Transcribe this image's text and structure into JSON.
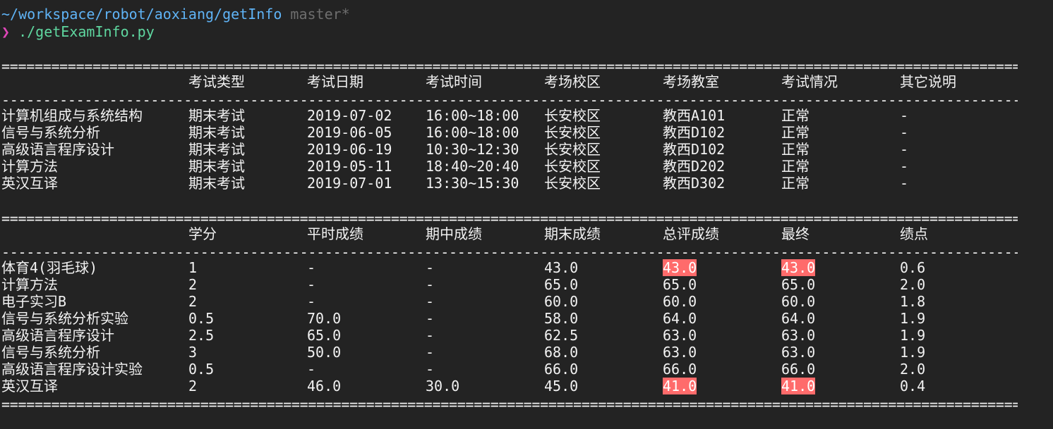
{
  "prompt": {
    "path": "~/workspace/robot/aoxiang/getInfo",
    "branch": "master*",
    "caret": "❯",
    "command": "./getExamInfo.py"
  },
  "exam_table": {
    "columns": [
      "",
      "考试类型",
      "考试日期",
      "考试时间",
      "考场校区",
      "考场教室",
      "考试情况",
      "其它说明"
    ],
    "rows": [
      [
        "计算机组成与系统结构",
        "期末考试",
        "2019-07-02",
        "16:00~18:00",
        "长安校区",
        "教西A101",
        "正常",
        "-"
      ],
      [
        "信号与系统分析",
        "期末考试",
        "2019-06-05",
        "16:00~18:00",
        "长安校区",
        "教西D102",
        "正常",
        "-"
      ],
      [
        "高级语言程序设计",
        "期末考试",
        "2019-06-19",
        "10:30~12:30",
        "长安校区",
        "教西D102",
        "正常",
        "-"
      ],
      [
        "计算方法",
        "期末考试",
        "2019-05-11",
        "18:40~20:40",
        "长安校区",
        "教西D202",
        "正常",
        "-"
      ],
      [
        "英汉互译",
        "期末考试",
        "2019-07-01",
        "13:30~15:30",
        "长安校区",
        "教西D302",
        "正常",
        "-"
      ]
    ]
  },
  "score_table": {
    "columns": [
      "",
      "学分",
      "平时成绩",
      "期中成绩",
      "期末成绩",
      "总评成绩",
      "最终",
      "绩点"
    ],
    "rows": [
      [
        "体育4(羽毛球)",
        "1",
        "-",
        "-",
        "43.0",
        "43.0",
        "43.0",
        "0.6"
      ],
      [
        "计算方法",
        "2",
        "-",
        "-",
        "65.0",
        "65.0",
        "65.0",
        "2.0"
      ],
      [
        "电子实习B",
        "2",
        "-",
        "-",
        "60.0",
        "60.0",
        "60.0",
        "1.8"
      ],
      [
        "信号与系统分析实验",
        "0.5",
        "70.0",
        "-",
        "58.0",
        "64.0",
        "64.0",
        "1.9"
      ],
      [
        "高级语言程序设计",
        "2.5",
        "65.0",
        "-",
        "62.5",
        "63.0",
        "63.0",
        "1.9"
      ],
      [
        "信号与系统分析",
        "3",
        "50.0",
        "-",
        "68.0",
        "63.0",
        "63.0",
        "1.9"
      ],
      [
        "高级语言程序设计实验",
        "0.5",
        "-",
        "-",
        "66.0",
        "66.0",
        "66.0",
        "2.0"
      ],
      [
        "英汉互译",
        "2",
        "46.0",
        "30.0",
        "45.0",
        "41.0",
        "41.0",
        "0.4"
      ]
    ],
    "failing_highlight": [
      [
        0,
        5
      ],
      [
        0,
        6
      ],
      [
        7,
        5
      ],
      [
        7,
        6
      ]
    ]
  },
  "colors": {
    "background": "#232323",
    "path": "#5fb3f5",
    "branch": "#6e6e6e",
    "caret": "#e046b8",
    "command": "#5fd7a0",
    "fail_highlight": "#ff6b6b"
  }
}
